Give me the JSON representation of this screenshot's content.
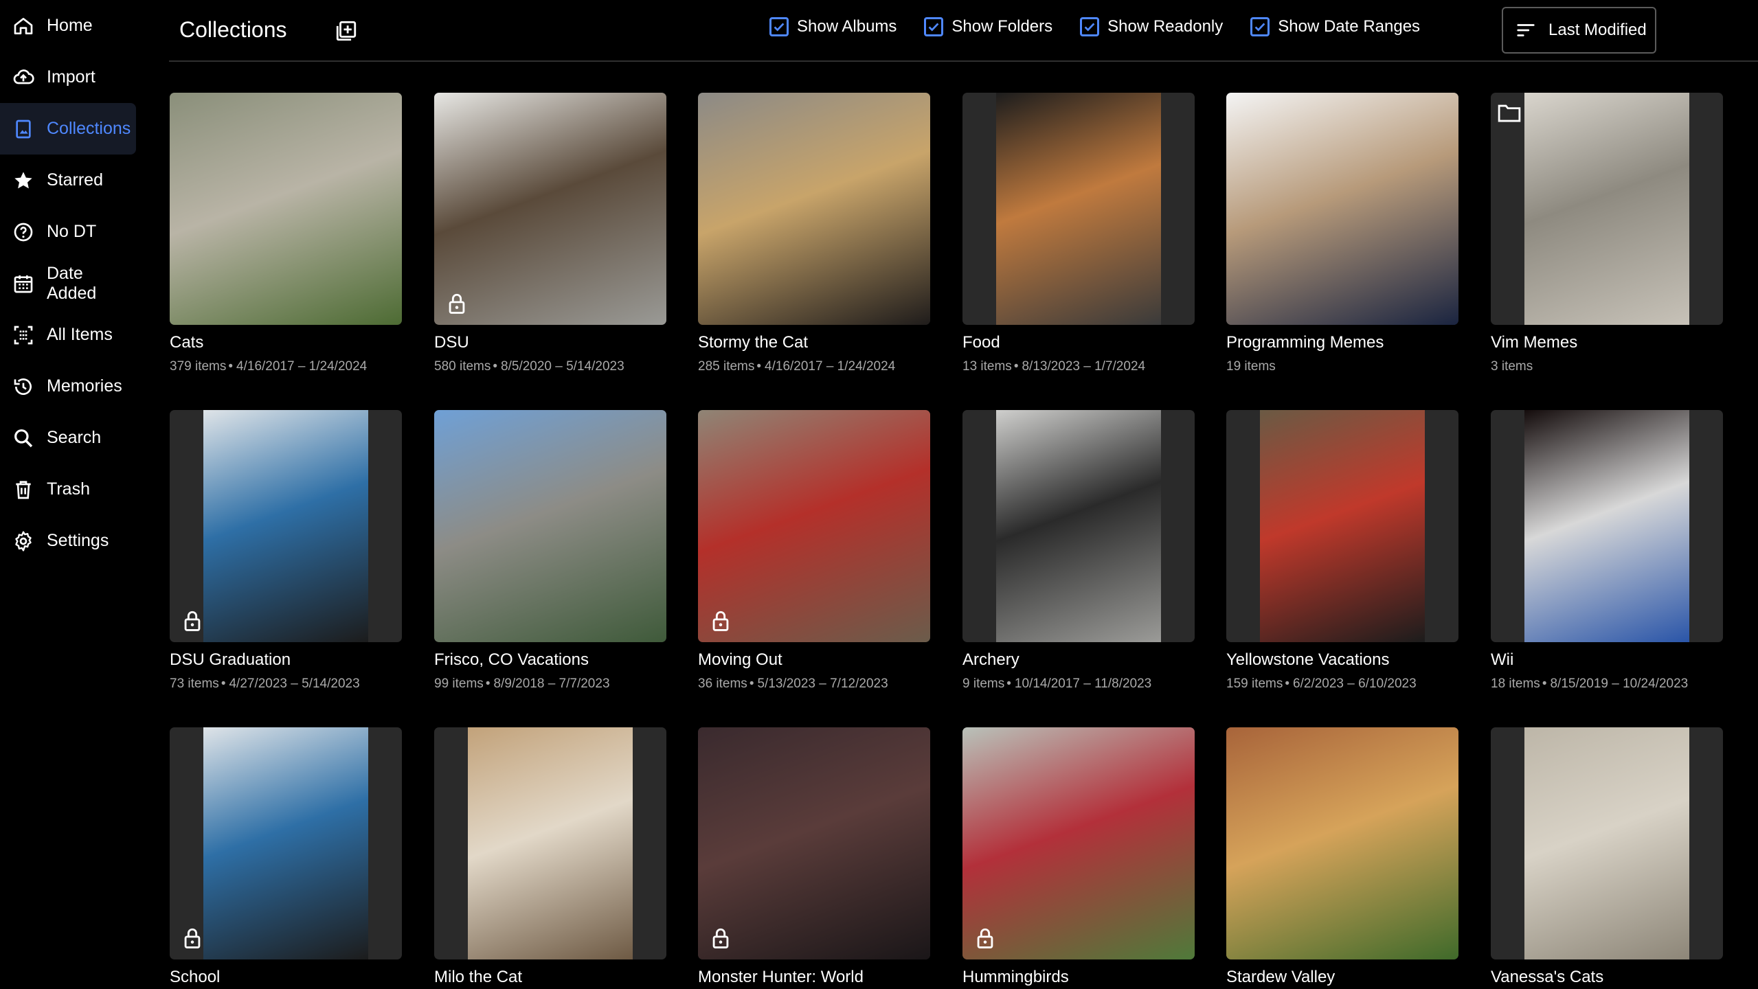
{
  "sidebar": {
    "items": [
      {
        "label": "Home",
        "icon": "home-icon"
      },
      {
        "label": "Import",
        "icon": "cloud-upload-icon"
      },
      {
        "label": "Collections",
        "icon": "collections-icon",
        "active": true
      },
      {
        "label": "Starred",
        "icon": "star-icon"
      },
      {
        "label": "No DT",
        "icon": "question-circle-icon"
      },
      {
        "label": "Date Added",
        "icon": "calendar-icon"
      },
      {
        "label": "All Items",
        "icon": "grid-dots-icon"
      },
      {
        "label": "Memories",
        "icon": "history-icon"
      },
      {
        "label": "Search",
        "icon": "search-icon"
      },
      {
        "label": "Trash",
        "icon": "trash-icon"
      },
      {
        "label": "Settings",
        "icon": "gear-icon"
      }
    ]
  },
  "header": {
    "title": "Collections",
    "add_icon": "add-collection-icon",
    "filters": [
      {
        "label": "Show Albums",
        "checked": true
      },
      {
        "label": "Show Folders",
        "checked": true
      },
      {
        "label": "Show Readonly",
        "checked": true
      },
      {
        "label": "Show Date Ranges",
        "checked": true
      }
    ],
    "sort_label": "Last Modified"
  },
  "colors": {
    "accent": "#4f88ff",
    "background": "#000000",
    "meta_text": "#a9a9a9",
    "active_nav_bg": "#151a26"
  },
  "collections": [
    {
      "title": "Cats",
      "count": "379 items",
      "range": "4/16/2017 – 1/24/2024",
      "locked": false,
      "folder": false,
      "thumb": {
        "colors": [
          "#8a8f7a",
          "#4d6b33",
          "#b9b4a6"
        ],
        "portrait": false
      }
    },
    {
      "title": "DSU",
      "count": "580 items",
      "range": "8/5/2020 – 5/14/2023",
      "locked": true,
      "folder": false,
      "thumb": {
        "colors": [
          "#e7e7e4",
          "#9a9a96",
          "#5a4a3a"
        ],
        "portrait": false
      }
    },
    {
      "title": "Stormy the Cat",
      "count": "285 items",
      "range": "4/16/2017 – 1/24/2024",
      "locked": false,
      "folder": false,
      "thumb": {
        "colors": [
          "#8c8a86",
          "#1f1c1b",
          "#c8a46a"
        ],
        "portrait": false
      }
    },
    {
      "title": "Food",
      "count": "13 items",
      "range": "8/13/2023 – 1/7/2024",
      "locked": false,
      "folder": false,
      "thumb": {
        "colors": [
          "#1d1d1d",
          "#3a3a3a",
          "#c07a3e"
        ],
        "portrait": true
      }
    },
    {
      "title": "Programming Memes",
      "count": "19 items",
      "range": "",
      "locked": false,
      "folder": false,
      "thumb": {
        "colors": [
          "#f4f4f4",
          "#1a2440",
          "#b79a7a"
        ],
        "portrait": false
      }
    },
    {
      "title": "Vim Memes",
      "count": "3 items",
      "range": "",
      "locked": false,
      "folder": true,
      "thumb": {
        "colors": [
          "#d9d5cd",
          "#c7c2b8",
          "#8e8a80"
        ],
        "portrait": true
      }
    },
    {
      "title": "DSU Graduation",
      "count": "73 items",
      "range": "4/27/2023 – 5/14/2023",
      "locked": true,
      "folder": false,
      "thumb": {
        "colors": [
          "#dfe4e8",
          "#1c1c1c",
          "#2e6fa6"
        ],
        "portrait": true
      }
    },
    {
      "title": "Frisco, CO Vacations",
      "count": "99 items",
      "range": "8/9/2018 – 7/7/2023",
      "locked": false,
      "folder": false,
      "thumb": {
        "colors": [
          "#6fa0d6",
          "#3f5a3a",
          "#8d8c86"
        ],
        "portrait": false
      }
    },
    {
      "title": "Moving Out",
      "count": "36 items",
      "range": "5/13/2023 – 7/12/2023",
      "locked": true,
      "folder": false,
      "thumb": {
        "colors": [
          "#8f8576",
          "#6b5c4b",
          "#b4302a"
        ],
        "portrait": false
      }
    },
    {
      "title": "Archery",
      "count": "9 items",
      "range": "10/14/2017 – 11/8/2023",
      "locked": false,
      "folder": false,
      "thumb": {
        "colors": [
          "#cfcfcd",
          "#9b9b98",
          "#2a2a2a"
        ],
        "portrait": true
      }
    },
    {
      "title": "Yellowstone Vacations",
      "count": "159 items",
      "range": "6/2/2023 – 6/10/2023",
      "locked": false,
      "folder": false,
      "thumb": {
        "colors": [
          "#6a5a44",
          "#1c1c1c",
          "#c0392b"
        ],
        "portrait": true
      }
    },
    {
      "title": "Wii",
      "count": "18 items",
      "range": "8/15/2019 – 10/24/2023",
      "locked": false,
      "folder": false,
      "thumb": {
        "colors": [
          "#140c0c",
          "#2a55a8",
          "#d8d8d8"
        ],
        "portrait": true
      }
    },
    {
      "title": "School",
      "count": "",
      "range": "",
      "locked": true,
      "folder": false,
      "thumb": {
        "colors": [
          "#dfe4e8",
          "#1c1c1c",
          "#2e6fa6"
        ],
        "portrait": true
      }
    },
    {
      "title": "Milo the Cat",
      "count": "",
      "range": "",
      "locked": false,
      "folder": false,
      "thumb": {
        "colors": [
          "#c2a27a",
          "#6e5a44",
          "#e2d8c8"
        ],
        "portrait": true
      }
    },
    {
      "title": "Monster Hunter: World",
      "count": "",
      "range": "",
      "locked": true,
      "folder": false,
      "thumb": {
        "colors": [
          "#3a2a2e",
          "#1a1618",
          "#5a3c3a"
        ],
        "portrait": false
      }
    },
    {
      "title": "Hummingbirds",
      "count": "",
      "range": "",
      "locked": true,
      "folder": false,
      "thumb": {
        "colors": [
          "#b9c2ba",
          "#4f7a3a",
          "#b3303a"
        ],
        "portrait": false
      }
    },
    {
      "title": "Stardew Valley",
      "count": "",
      "range": "",
      "locked": false,
      "folder": false,
      "thumb": {
        "colors": [
          "#a8643a",
          "#3f6a2a",
          "#d6a35a"
        ],
        "portrait": false
      }
    },
    {
      "title": "Vanessa's Cats",
      "count": "",
      "range": "",
      "locked": false,
      "folder": false,
      "thumb": {
        "colors": [
          "#bdb6a8",
          "#8d8678",
          "#d8d2c6"
        ],
        "portrait": true
      }
    }
  ]
}
